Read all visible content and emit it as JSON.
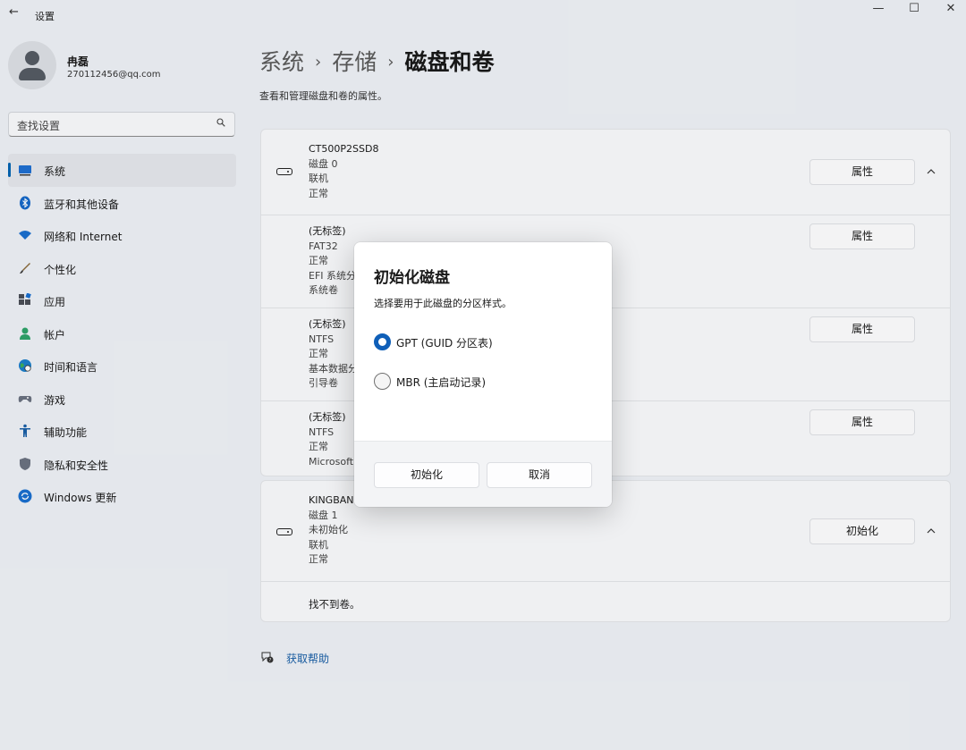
{
  "window": {
    "title": "设置",
    "back_glyph": "←",
    "minimize_glyph": "—",
    "maximize_glyph": "☐",
    "close_glyph": "✕"
  },
  "profile": {
    "name": "冉磊",
    "email": "270112456@qq.com"
  },
  "search": {
    "placeholder": "查找设置"
  },
  "nav": [
    {
      "label": "系统",
      "icon": "system-icon",
      "active": true
    },
    {
      "label": "蓝牙和其他设备",
      "icon": "bluetooth-icon"
    },
    {
      "label": "网络和 Internet",
      "icon": "wifi-icon"
    },
    {
      "label": "个性化",
      "icon": "brush-icon"
    },
    {
      "label": "应用",
      "icon": "apps-icon"
    },
    {
      "label": "帐户",
      "icon": "account-icon"
    },
    {
      "label": "时间和语言",
      "icon": "globe-clock-icon"
    },
    {
      "label": "游戏",
      "icon": "gamepad-icon"
    },
    {
      "label": "辅助功能",
      "icon": "accessibility-icon"
    },
    {
      "label": "隐私和安全性",
      "icon": "shield-icon"
    },
    {
      "label": "Windows 更新",
      "icon": "update-icon"
    }
  ],
  "breadcrumb": {
    "items": [
      "系统",
      "存储",
      "磁盘和卷"
    ],
    "separator": "›"
  },
  "description": "查看和管理磁盘和卷的属性。",
  "disk0": {
    "header": {
      "lines": [
        "CT500P2SSD8",
        "磁盘 0",
        "联机",
        "正常"
      ],
      "button": "属性",
      "chevron": "^"
    },
    "volumes": [
      {
        "lines": [
          "(无标签)",
          "FAT32",
          "正常",
          "EFI 系统分区",
          "系统卷"
        ],
        "button": "属性"
      },
      {
        "lines": [
          "(无标签)",
          "NTFS",
          "正常",
          "基本数据分区",
          "引导卷"
        ],
        "button": "属性"
      },
      {
        "lines": [
          "(无标签)",
          "NTFS",
          "正常",
          "Microsoft"
        ],
        "button": "属性"
      }
    ]
  },
  "disk1": {
    "header": {
      "lines": [
        "KINGBAN",
        "磁盘 1",
        "未初始化",
        "联机",
        "正常"
      ],
      "button": "初始化",
      "chevron": "^"
    },
    "no_volumes": "找不到卷。"
  },
  "help": {
    "label": "获取帮助"
  },
  "dialog": {
    "title": "初始化磁盘",
    "subtitle": "选择要用于此磁盘的分区样式。",
    "options": [
      {
        "label": "GPT (GUID 分区表)",
        "selected": true
      },
      {
        "label": "MBR (主启动记录)",
        "selected": false
      }
    ],
    "primary_button": "初始化",
    "cancel_button": "取消"
  },
  "colors": {
    "accent": "#0f5fb8",
    "link": "#1a5fa6",
    "background": "#eef1f6"
  }
}
